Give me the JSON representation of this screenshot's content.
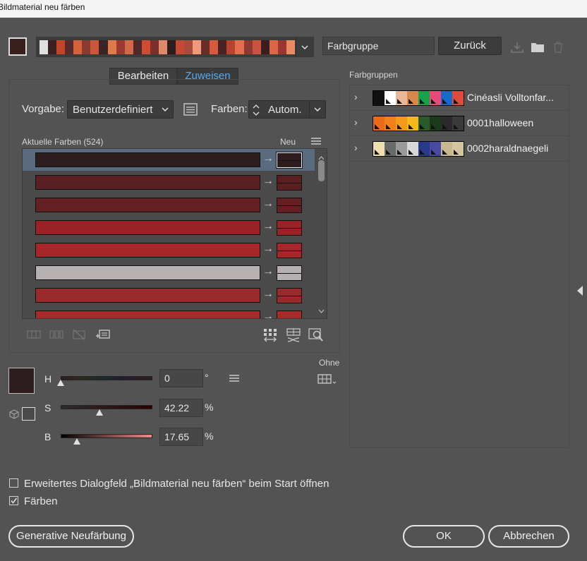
{
  "window": {
    "title": "Bildmaterial neu färben"
  },
  "top": {
    "group_name_value": "Farbgruppe",
    "back_label": "Zurück",
    "main_swatch_color": "#3a1f1f",
    "color_bar_colors": [
      "#e0e0e0",
      "#3a2020",
      "#c0452a",
      "#5a2a2a",
      "#d4623a",
      "#8a3a2e",
      "#c8583c",
      "#3d2424",
      "#e07a4a",
      "#9b3a30",
      "#d06a4a",
      "#512828",
      "#cf4c34",
      "#7a302a",
      "#de8a6a",
      "#2e1c1c",
      "#c44a36",
      "#a84a3c",
      "#ef9a7a",
      "#6a2c26",
      "#d85a3e",
      "#4a2222",
      "#b8422e",
      "#e27050",
      "#8e3a30",
      "#c65440",
      "#3a1e1e",
      "#da6848",
      "#9a3630",
      "#e88a62"
    ]
  },
  "tabs": {
    "edit": "Bearbeiten",
    "assign": "Zuweisen"
  },
  "controls": {
    "preset_label": "Vorgabe:",
    "preset_value": "Benutzerdefiniert",
    "colors_label": "Farben:",
    "colors_value": "Autom."
  },
  "list": {
    "header": "Aktuelle Farben (524)",
    "new_header": "Neu",
    "rows": [
      {
        "color": "#2e1d1f"
      },
      {
        "color": "#5a1f22"
      },
      {
        "color": "#641f22"
      },
      {
        "color": "#9a2226"
      },
      {
        "color": "#a6262a"
      },
      {
        "color": "#b6b0b0"
      },
      {
        "color": "#992a2c"
      },
      {
        "color": "#a82a2a"
      }
    ]
  },
  "hsb": {
    "h_label": "H",
    "h_value": "0",
    "h_unit": "°",
    "s_label": "S",
    "s_value": "42.22",
    "s_unit": "%",
    "b_label": "B",
    "b_value": "17.65",
    "b_unit": "%",
    "h_level": 0.0,
    "s_level": 0.4222,
    "b_level": 0.1765,
    "color": "#2e1d1f"
  },
  "none_label": "Ohne",
  "farbgruppen": {
    "title": "Farbgruppen",
    "items": [
      {
        "name": "Cinéasli Volltonfar...",
        "colors": [
          "#111111",
          "#ffffff",
          "#e8b898",
          "#d8884a",
          "#1aa04a",
          "#e84a7a",
          "#1a6ac8",
          "#e04a3a"
        ]
      },
      {
        "name": "0001halloween",
        "colors": [
          "#e86a1a",
          "#f0801a",
          "#f49a1a",
          "#f4b81a",
          "#2a5a2a",
          "#1a3a1a",
          "#2a2a2a",
          "#3a3a3a"
        ]
      },
      {
        "name": "0002haraldnaegeli",
        "colors": [
          "#f0e0b0",
          "#6a6a6a",
          "#9a9a9a",
          "#d8d8d8",
          "#2a3a8a",
          "#4a4aa0",
          "#c8b890",
          "#d4c4a0"
        ]
      }
    ]
  },
  "options": {
    "advanced_label": "Erweitertes Dialogfeld „Bildmaterial neu färben“ beim Start öffnen",
    "recolor_label": "Färben"
  },
  "buttons": {
    "generative": "Generative Neufärbung",
    "ok": "OK",
    "cancel": "Abbrechen"
  }
}
